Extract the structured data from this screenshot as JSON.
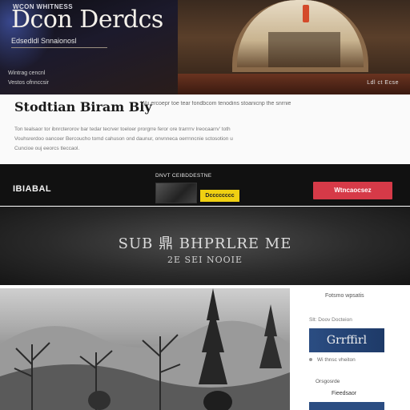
{
  "hero": {
    "tag": "WCON WHITNESS",
    "title": "Dcon Derdcs",
    "subtitle": "Edsedldl Snnaionosl",
    "meta_line_1": "Wintrag cencnl",
    "meta_line_2": "Vestos ofnnccsir",
    "corner_text": "Ldl ct Ecse"
  },
  "article": {
    "title": "Stodtian Biram Bly",
    "tagline": "Wu ercoepr toe tear fondbcom tenodins stoanicnp the snrnie",
    "body_line_1": "Ton tealsaor tor ibnrcterorov bar tedar tecrver toeloer prorgrre feror ore trarrrrv Ireocaarrv' toth",
    "body_line_2": "Vouhsrerdoo oancoer Bercoucho tomd cahuson ond daunur, onvnneca oerrnncnie sctosotion u",
    "body_line_3": "Cuncioe ouj eeorcs tleccaol."
  },
  "band": {
    "logo": "IBIABAL",
    "caption": "DNVT CEIBDDESTNE",
    "badge": "Dcccccccc",
    "cta": "Wtncaocsez"
  },
  "feature": {
    "title": "SUB 鼎 BHPRLRE ME",
    "subtitle": "2E SEI NOOIE"
  },
  "sidebar": {
    "heading": "Fotsmo wpsatis",
    "line_1": "Slt: Doov Docteion",
    "brand": "Grrffirl",
    "row_1": "Wi thnsc vheiton",
    "link": "Orsgosrde",
    "label": "Fieedsaor"
  },
  "colors": {
    "band_cta": "#d63a48",
    "band_badge": "#f0d012",
    "sidebar_brand": "#2b4d82"
  }
}
